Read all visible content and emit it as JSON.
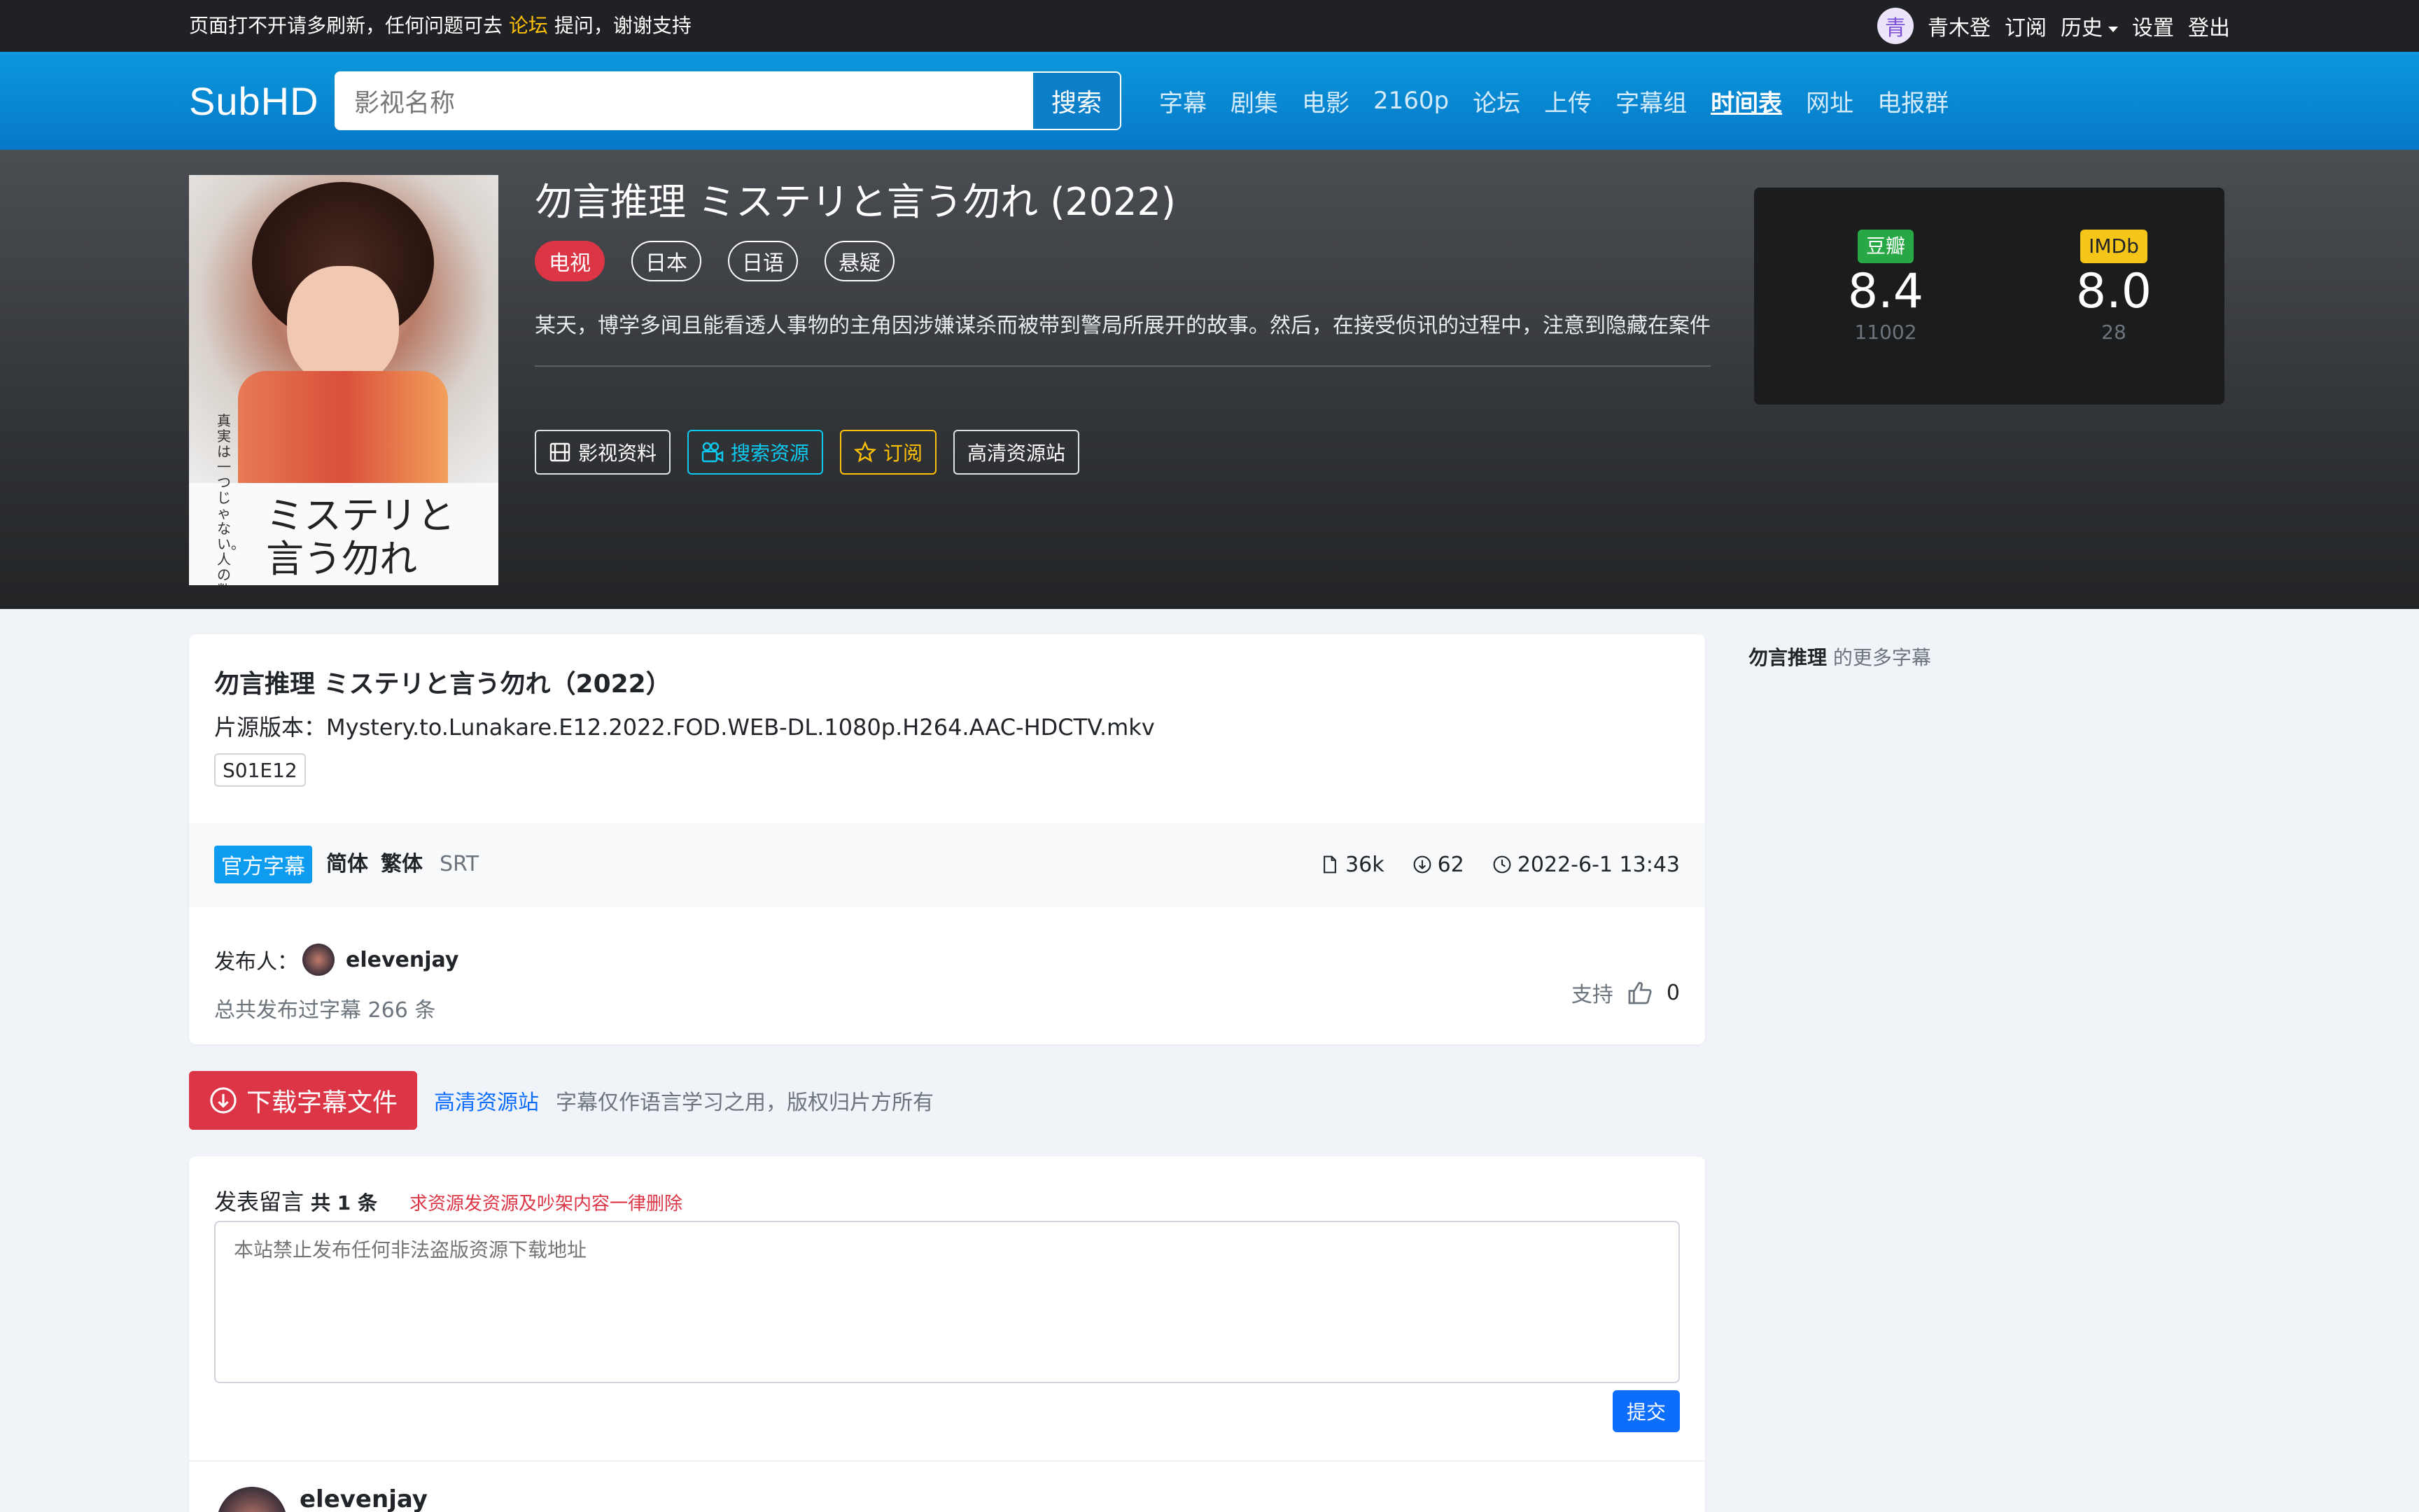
{
  "topbar": {
    "notice_prefix": "页面打不开请多刷新，任何问题可去 ",
    "notice_link": "论坛",
    "notice_suffix": " 提问，谢谢支持",
    "avatar_char": "青",
    "username": "青木登",
    "subscribe": "订阅",
    "history": "历史",
    "settings": "设置",
    "logout": "登出"
  },
  "header": {
    "logo": "SubHD",
    "search_placeholder": "影视名称",
    "search_button": "搜索",
    "nav": [
      "字幕",
      "剧集",
      "电影",
      "2160p",
      "论坛",
      "上传",
      "字幕组",
      "时间表",
      "网址",
      "电报群"
    ],
    "nav_active": "时间表"
  },
  "hero": {
    "poster_title": "ミステリと言う勿れ",
    "poster_tagline": "真実は一つじゃない。人の数だけある。",
    "title": "勿言推理 ミステリと言う勿れ (2022)",
    "tags": [
      "电视",
      "日本",
      "日语",
      "悬疑"
    ],
    "description": "某天，博学多闻且能看透人事物的主角因涉嫌谋杀而被带到警局所展开的故事。然后，在接受侦讯的过程中，注意到隐藏在案件",
    "actions": {
      "info": "影视资料",
      "search": "搜索资源",
      "subscribe": "订阅",
      "hd_site": "高清资源站"
    },
    "ratings": {
      "douban_label": "豆瓣",
      "douban_score": "8.4",
      "douban_count": "11002",
      "douban_color": "#28a745",
      "imdb_label": "IMDb",
      "imdb_score": "8.0",
      "imdb_count": "28",
      "imdb_color": "#f5c518"
    }
  },
  "subtitle": {
    "title": "勿言推理 ミステリと言う勿れ（2022）",
    "source_label": "片源版本：",
    "source": "Mystery.to.Lunakare.E12.2022.FOD.WEB-DL.1080p.H264.AAC-HDCTV.mkv",
    "episode": "S01E12",
    "badge": "官方字幕",
    "lang1": "简体",
    "lang2": "繁体",
    "format": "SRT",
    "size": "36k",
    "downloads": "62",
    "date": "2022-6-1 13:43",
    "publisher_label": "发布人：",
    "publisher": "elevenjay",
    "total": "总共发布过字幕 266 条",
    "support_label": "支持",
    "support_count": "0"
  },
  "side": {
    "bold": "勿言推理",
    "suffix": " 的更多字幕"
  },
  "download": {
    "button": "下载字幕文件",
    "link": "高清资源站",
    "note": "字幕仅作语言学习之用，版权归片方所有"
  },
  "comments": {
    "title": "发表留言",
    "count": "共 1 条",
    "warning": "求资源发资源及吵架内容一律删除",
    "placeholder": "本站禁止发布任何非法盗版资源下载地址",
    "submit": "提交",
    "first_user": "elevenjay"
  }
}
